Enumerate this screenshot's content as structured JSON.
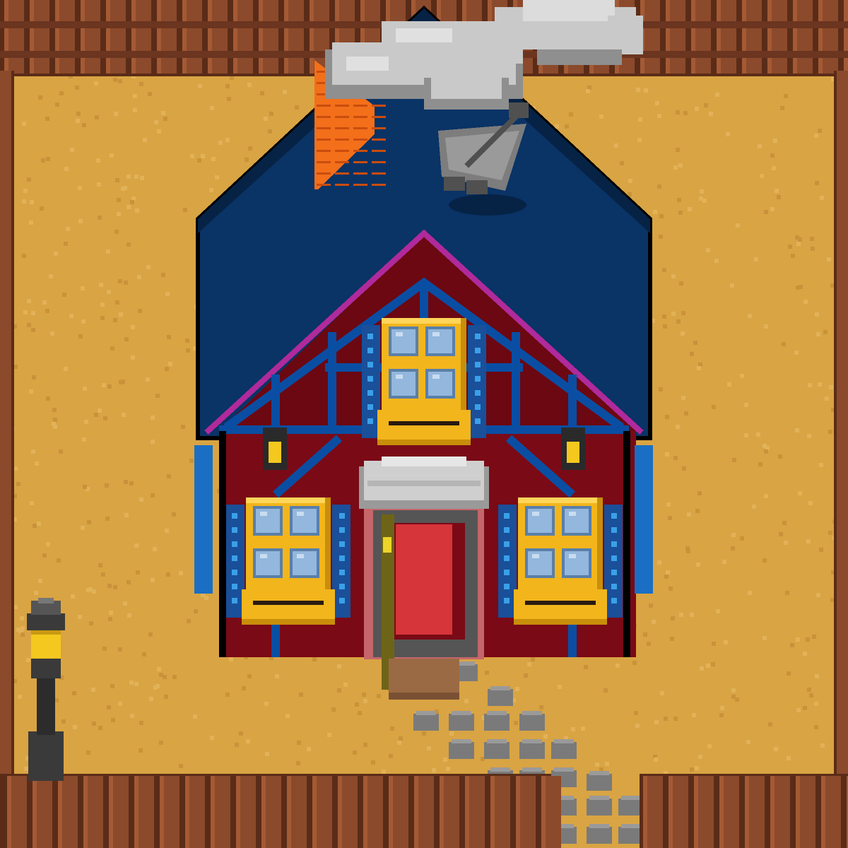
{
  "scene": {
    "kind": "pixel-art farmhouse",
    "colors": {
      "ground": "#d9a443",
      "ground_speckle": "#c9923a",
      "fence_wood": "#8b4a2b",
      "fence_dark": "#5a2c18",
      "roof": "#0a3366",
      "roof_dark": "#062346",
      "roof_trim": "#b02a9c",
      "wall": "#7a0a16",
      "wall_dark": "#5c0710",
      "timber": "#0a4ea3",
      "window_frame": "#f2b51c",
      "window_glass": "#93b7dd",
      "shutter": "#1a6fc4",
      "door": "#d6353a",
      "chimney": "#f36f1a",
      "smoke": "#c9c9c9",
      "stone": "#8a8a8a",
      "lamp_glow": "#f5c81f",
      "lamp_post": "#2c2c2c"
    },
    "objects": {
      "fence": {
        "icon": "wooden-fence-icon"
      },
      "house": {
        "icon": "farmhouse-icon"
      },
      "chimney": {
        "icon": "brick-chimney-icon"
      },
      "smoke": {
        "icon": "smoke-cloud-icon"
      },
      "satellite_dish": {
        "icon": "satellite-dish-icon"
      },
      "lamp_post": {
        "icon": "street-lamp-icon"
      },
      "path": {
        "icon": "stone-path-icon"
      }
    }
  }
}
